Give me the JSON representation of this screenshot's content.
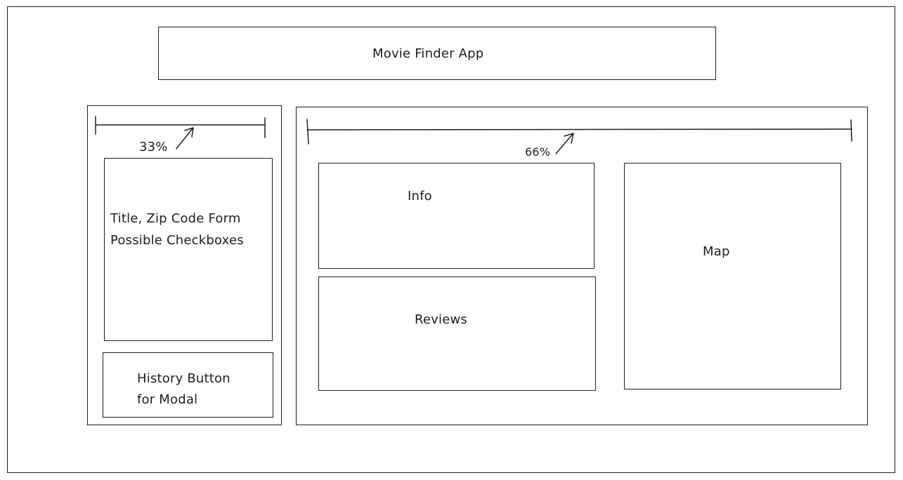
{
  "header": {
    "title": "Movie Finder App"
  },
  "left_column": {
    "width_label": "33%",
    "form_box": {
      "line1": "Title, Zip Code Form",
      "line2": "Possible Checkboxes"
    },
    "history_box": {
      "line1": "History Button",
      "line2": "for Modal"
    }
  },
  "right_column": {
    "width_label": "66%",
    "info_box": {
      "label": "Info"
    },
    "reviews_box": {
      "label": "Reviews"
    },
    "map_box": {
      "label": "Map"
    }
  },
  "colors": {
    "stroke": "#1e1e1e",
    "background": "#ffffff"
  }
}
